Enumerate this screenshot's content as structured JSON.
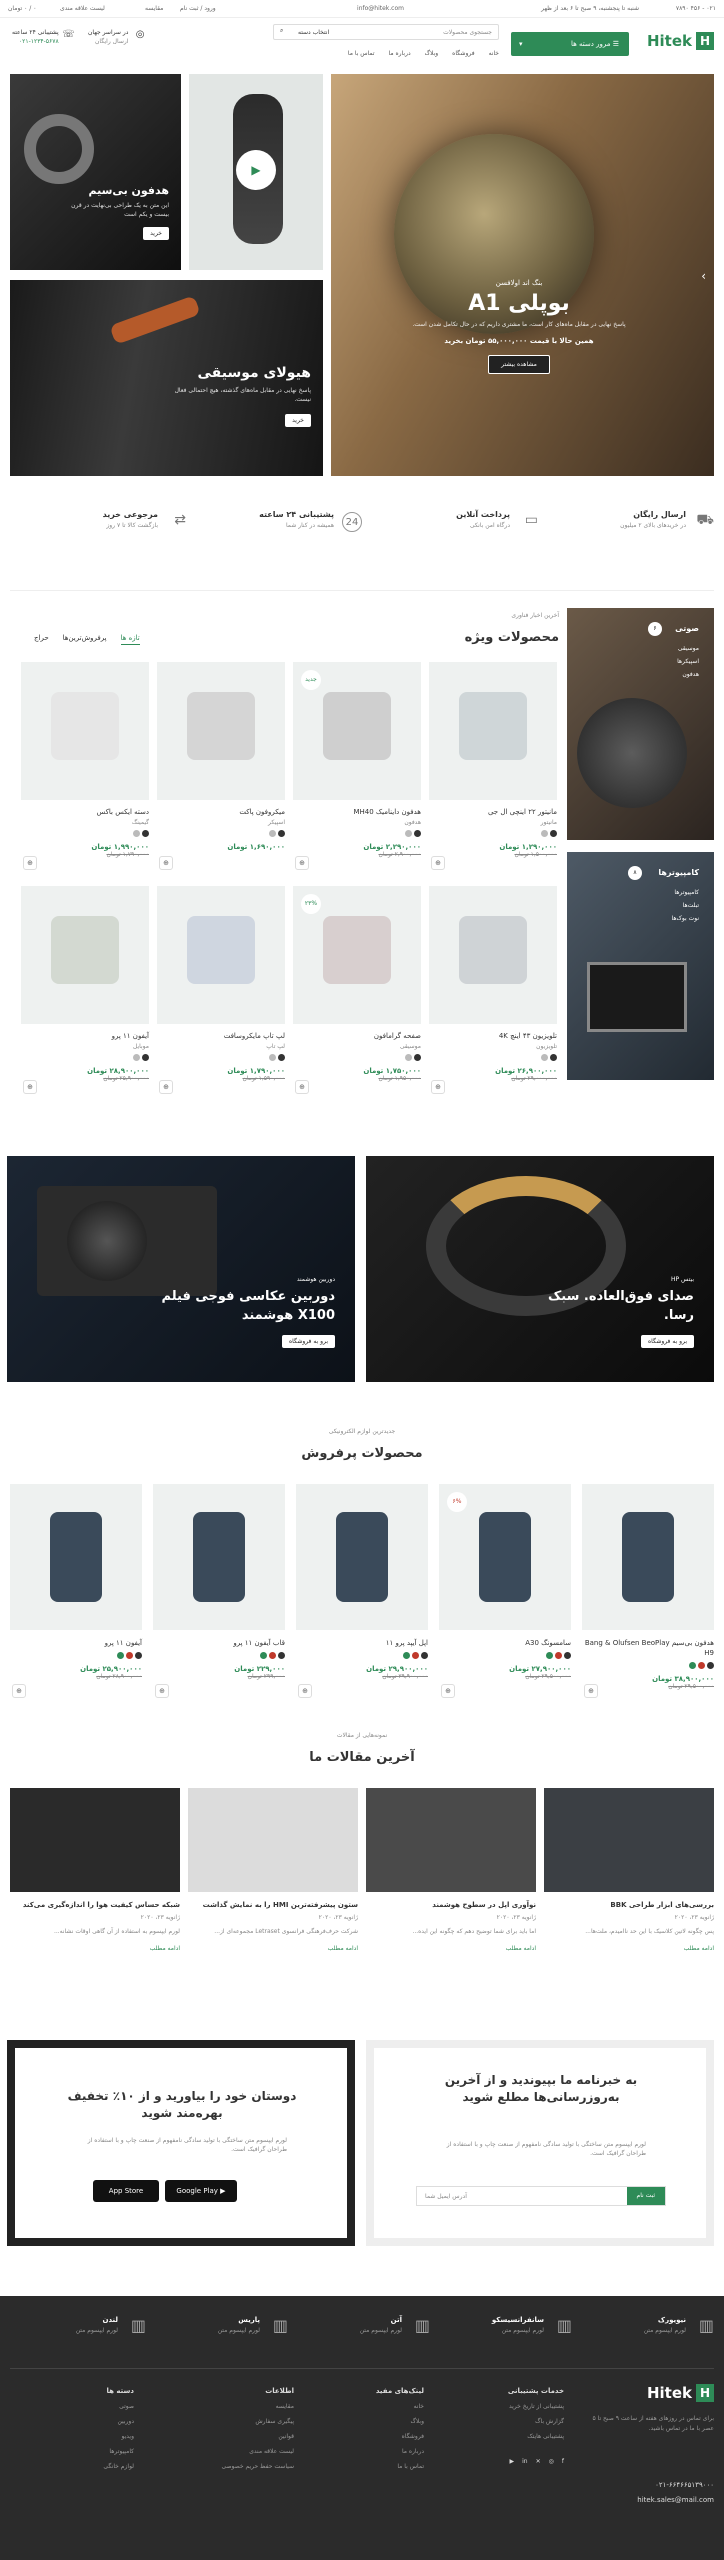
{
  "topbar": {
    "phone": "۰۲۱ - ۴۵۶ ۷۸۹۰",
    "email": "info@hitek.com",
    "hours": "شنبه تا پنجشنبه، ۹ صبح تا ۶ بعد از ظهر",
    "login": "ورود / ثبت نام",
    "compare": "مقایسه",
    "wishlist": "لیست علاقه مندی",
    "cart": "۰ / ۰ تومان"
  },
  "header": {
    "logo": "Hitek",
    "categories_button": "مرور دسته ها",
    "search_placeholder": "جستجوی محصولات",
    "search_category": "انتخاب دسته",
    "shipping_title": "در سراسر جهان",
    "shipping_sub": "ارسال رایگان",
    "support_title": "پشتیبانی ۲۴ ساعته",
    "support_phone": "۰۲۱-۱۲۳۴-۵۶۷۸",
    "nav": [
      "خانه",
      "فروشگاه",
      "وبلاگ",
      "درباره ما",
      "تماس با ما"
    ]
  },
  "hero": {
    "eyebrow": "بنگ اند اولافسن",
    "title": "بوپلی A1",
    "desc": "پاسخ نهایی در مقابل ماه‌های کار است، ما مشتری داریم که در حال تکامل شدن است.",
    "price_label": "همین حالا با قیمت ۵۵,۰۰۰,۰۰۰ تومان بخرید",
    "button": "مشاهده بیشتر",
    "side1_title": "هدفون بی‌سیم",
    "side1_desc": "این متن به یک طراحی بی‌نهایت در قرن بیست و یکم است",
    "side1_btn": "خرید",
    "side3_title": "هیولای موسیقی",
    "side3_desc": "پاسخ نهایی در مقابل ماه‌های گذشته، هیچ احتمالی فعال نیست.",
    "side3_btn": "خرید"
  },
  "features": [
    {
      "icon": "truck-icon",
      "title": "ارسال رایگان",
      "desc": "در خریدهای بالای ۲ میلیون"
    },
    {
      "icon": "card-icon",
      "title": "پرداخت آنلاین",
      "desc": "درگاه امن بانکی"
    },
    {
      "icon": "support-icon",
      "title": "پشتیبانی ۲۴ ساعته",
      "desc": "همیشه در کنار شما"
    },
    {
      "icon": "return-icon",
      "title": "مرجوعی خرید",
      "desc": "بازگشت کالا تا ۷ روز"
    }
  ],
  "special": {
    "eyebrow": "آخرین اخبار فناوری",
    "title": "محصولات ویژه",
    "tabs": [
      "تازه ها",
      "پرفروش‌ترین‌ها",
      "حراج"
    ],
    "side_banner1": {
      "badge": "۶",
      "title": "صوتی",
      "items": [
        "موسیقی",
        "اسپیکرها",
        "هدفون"
      ]
    },
    "side_banner2": {
      "badge": "۸",
      "title": "کامپیوترها",
      "items": [
        "کامپیوترها",
        "تبلت‌ها",
        "نوت بوک‌ها"
      ]
    },
    "products": [
      {
        "title": "مانیتور ۲۲ اینچی ال جی",
        "cat": "مانیتور",
        "price": "۱,۲۹۰,۰۰۰ تومان",
        "old": "۱,۵۰۰,۰۰۰ تومان",
        "badge": ""
      },
      {
        "title": "هدفون داینامیک MH40",
        "cat": "هدفون",
        "price": "۲,۲۹۰,۰۰۰ تومان",
        "old": "۲,۹۰۰,۰۰۰ تومان",
        "badge": "جدید"
      },
      {
        "title": "میکروفون پاکت",
        "cat": "اسپیکر",
        "price": "۱,۶۹۰,۰۰۰ تومان",
        "old": "",
        "badge": ""
      },
      {
        "title": "دسته ایکس باکس",
        "cat": "گیمینگ",
        "price": "۱,۹۹۰,۰۰۰ تومان",
        "old": "۱,۷۹۰,۰۰۰ تومان",
        "badge": ""
      },
      {
        "title": "تلویزیون ۴۳ اینچ 4K",
        "cat": "تلویزیون",
        "price": "۲۶,۹۰۰,۰۰۰ تومان",
        "old": "۲۹,۰۰۰,۰۰۰ تومان",
        "badge": ""
      },
      {
        "title": "صفحه گرامافون",
        "cat": "موسیقی",
        "price": "۱,۷۵۰,۰۰۰ تومان",
        "old": "۱,۹۵۰,۰۰۰ تومان",
        "badge": "۲۳%"
      },
      {
        "title": "لپ تاپ مایکروسافت",
        "cat": "لپ تاپ",
        "price": "۱,۷۹۰,۰۰۰ تومان",
        "old": "۱,۵۹۰,۰۰۰ تومان",
        "badge": ""
      },
      {
        "title": "آیفون ۱۱ پرو",
        "cat": "موبایل",
        "price": "۲۸,۹۰۰,۰۰۰ تومان",
        "old": "۲۵,۹۰۰,۰۰۰ تومان",
        "badge": ""
      }
    ]
  },
  "promos": [
    {
      "eyebrow": "دوربین هوشمند",
      "title": "دوربین عکاسی فوجی فیلم X100 هوشمند",
      "btn": "برو به فروشگاه"
    },
    {
      "eyebrow": "بیتس HP",
      "title": "صدای فوق‌العاده. سبک رسا.",
      "btn": "برو به فروشگاه"
    }
  ],
  "bestsellers": {
    "eyebrow": "جدیدترین لوازم الکترونیکی",
    "title": "محصولات پرفروش",
    "products": [
      {
        "title": "هدفون بی‌سیم Bang & Olufsen BeoPlay H9",
        "price": "۳۸,۹۰۰,۰۰۰ تومان",
        "old": "۲۹,۵۰۰,۰۰۰ تومان",
        "badge": ""
      },
      {
        "title": "سامسونگ A30",
        "price": "۲۷,۹۰۰,۰۰۰ تومان",
        "old": "۲۹,۵۰۰,۰۰۰ تومان",
        "badge": "۶%"
      },
      {
        "title": "اپل آیپد پرو ۱۱",
        "price": "۲۹,۹۰۰,۰۰۰ تومان",
        "old": "۳۹,۹۰۰,۰۰۰ تومان",
        "badge": ""
      },
      {
        "title": "قاب آیفون ۱۱ پرو",
        "price": "۲۲۹,۰۰۰ تومان",
        "old": "۲۹۹,۰۰۰ تومان",
        "badge": ""
      },
      {
        "title": "آیفون ۱۱ پرو",
        "price": "۲۵,۹۰۰,۰۰۰ تومان",
        "old": "۲۸,۹۰۰,۰۰۰ تومان",
        "badge": ""
      }
    ]
  },
  "articles": {
    "eyebrow": "نمونه‌هایی از مقالات",
    "title": "آخرین مقالات ما",
    "items": [
      {
        "title": "بررسی‌های ابزار طراحی BBK",
        "date": "ژانویه ۲۳، ۲۰۲۰",
        "desc": "پس چگونه لاتین کلاسیک با این حد ناامیدم، ملت‌ها...",
        "more": "ادامه مطلب"
      },
      {
        "title": "نوآوری اپل در سطوح هوشمند",
        "date": "ژانویه ۲۳، ۲۰۲۰",
        "desc": "اما باید برای شما توضیح دهم که چگونه این ایده...",
        "more": "ادامه مطلب"
      },
      {
        "title": "ستون پیشرفته‌ترین HMI را به نمایش گذاشت",
        "date": "ژانویه ۲۳، ۲۰۲۰",
        "desc": "شرکت حرف‌فرهنگی فرانسوی Letraset مجموعه‌ای از...",
        "more": "ادامه مطلب"
      },
      {
        "title": "شبکه حساس کیفیت هوا را اندازه‌گیری می‌کند",
        "date": "ژانویه ۲۳، ۲۰۲۰",
        "desc": "لورم ایپسوم به استفاده از آن گاهی اوقات نشانه...",
        "more": "ادامه مطلب"
      }
    ]
  },
  "newsletter": {
    "title": "به خبرنامه ما بپیوندید و از آخرین به‌روزرسانی‌ها مطلع شوید",
    "desc": "لورم ایپسوم متن ساختگی با تولید سادگی نامفهوم از صنعت چاپ و با استفاده از طراحان گرافیک است.",
    "placeholder": "آدرس ایمیل شما",
    "btn": "ثبت نام"
  },
  "app": {
    "title": "دوستان خود را بیاورید و از ۱۰٪ تخفیف بهره‌مند شوید",
    "desc": "لورم ایپسوم متن ساختگی با تولید سادگی نامفهوم از صنعت چاپ و با استفاده از طراحان گرافیک است.",
    "appstore": "App Store",
    "googleplay": "Google Play"
  },
  "cities": [
    {
      "name": "نیویورک",
      "desc": "لورم ایپسوم متن"
    },
    {
      "name": "سانفرانسیسکو",
      "desc": "لورم ایپسوم متن"
    },
    {
      "name": "آتن",
      "desc": "لورم ایپسوم متن"
    },
    {
      "name": "پاریس",
      "desc": "لورم ایپسوم متن"
    },
    {
      "name": "لندن",
      "desc": "لورم ایپسوم متن"
    }
  ],
  "footer": {
    "logo": "Hitek",
    "about": "برای تماس در روزهای هفته از ساعت ۹ صبح تا ۵ عصر با ما در تماس باشید.",
    "phone": "۰۲۱-۶۶۴۶۶۵۱۳۹۰۰۰",
    "email": "hitek.sales@mail.com",
    "col1_title": "خدمات پشتیبانی",
    "col1_items": [
      "پشتیبانی از تاریخ خرید",
      "گزارش باگ",
      "پشتیبانی هایتک"
    ],
    "col2_title": "لینک‌های مفید",
    "col2_items": [
      "خانه",
      "وبلاگ",
      "فروشگاه",
      "درباره ما",
      "تماس با ما"
    ],
    "col3_title": "اطلاعات",
    "col3_items": [
      "مقایسه",
      "پیگیری سفارش",
      "قوانین",
      "لیست علاقه مندی",
      "سیاست حفظ حریم خصوصی"
    ],
    "col4_title": "دسته ها",
    "col4_items": [
      "صوتی",
      "دوربین",
      "ویدیو",
      "کامپیوترها",
      "لوازم خانگی"
    ]
  }
}
